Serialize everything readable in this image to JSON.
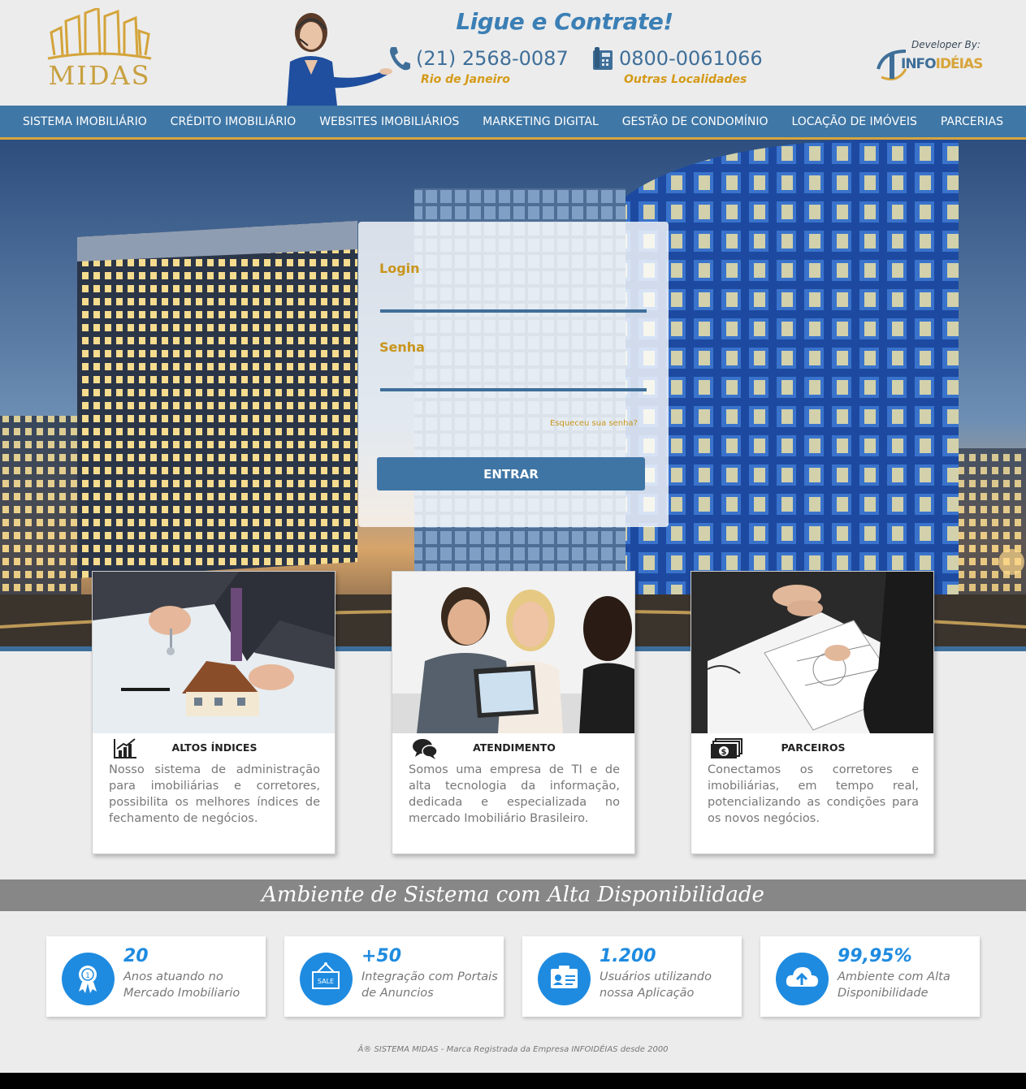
{
  "header": {
    "logo_text": "MIDAS",
    "headline": "Ligue e Contrate!",
    "phones": [
      {
        "number": "(21) 2568-0087",
        "location": "Rio de Janeiro",
        "icon": "phone-handset-icon"
      },
      {
        "number": "0800-0061066",
        "location": "Outras Localidades",
        "icon": "desk-phone-icon"
      }
    ],
    "developer_label": "Developer By:",
    "developer_logo_text_a": "INFO",
    "developer_logo_text_b": "IDÉIAS"
  },
  "nav": {
    "items": [
      "SISTEMA IMOBILIÁRIO",
      "CRÉDITO IMOBILIÁRIO",
      "WEBSITES IMOBILIÁRIOS",
      "MARKETING DIGITAL",
      "GESTÃO DE CONDOMÍNIO",
      "LOCAÇÃO DE IMÓVEIS",
      "PARCERIAS"
    ]
  },
  "login": {
    "login_label": "Login",
    "login_value": "",
    "password_label": "Senha",
    "password_value": "",
    "forgot_label": "Esqueceu sua senha?",
    "submit_label": "ENTRAR"
  },
  "features": [
    {
      "icon": "bar-chart-icon",
      "title": "ALTOS ÍNDICES",
      "text": "Nosso sistema de administração para imobiliárias e corretores, possibilita os melhores índices de fechamento de negócios."
    },
    {
      "icon": "chat-bubbles-icon",
      "title": "ATENDIMENTO",
      "text": "Somos uma empresa de TI e de alta tecnologia da informação, dedicada e especializada no mercado Imobiliário Brasileiro."
    },
    {
      "icon": "money-icon",
      "title": "PARCEIROS",
      "text": "Conectamos os corretores e imobiliárias, em tempo real, potencializando as condições para os novos negócios."
    }
  ],
  "banner": {
    "text": "Ambiente de Sistema com Alta Disponibilidade"
  },
  "stats": [
    {
      "icon": "award-ribbon-icon",
      "value": "20",
      "label": "Anos atuando no Mercado Imobiliario"
    },
    {
      "icon": "sale-sign-icon",
      "value": "+50",
      "label": "Integração com Portais de Anuncios",
      "sign_text": "SALE"
    },
    {
      "icon": "id-card-icon",
      "value": "1.200",
      "label": "Usuários utilizando nossa Aplicação"
    },
    {
      "icon": "cloud-upload-icon",
      "value": "99,95%",
      "label": "Ambiente com Alta Disponibilidade"
    }
  ],
  "footer": {
    "text": "Â® SISTEMA MIDAS - Marca Registrada da Empresa INFOIDÉIAS desde 2000"
  },
  "colors": {
    "brand_blue": "#3f77a6",
    "gold": "#d8a53b",
    "stat_blue": "#1f8be0",
    "banner_gray": "#878787"
  }
}
